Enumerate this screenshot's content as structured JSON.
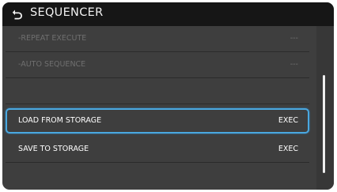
{
  "header": {
    "title": "SEQUENCER",
    "back_icon": "back-arrow-icon"
  },
  "rows": [
    {
      "label": "-REPEAT EXECUTE",
      "value": "---",
      "state": "disabled"
    },
    {
      "label": "-AUTO SEQUENCE",
      "value": "---",
      "state": "disabled"
    },
    {
      "label": "",
      "value": "",
      "state": "empty"
    },
    {
      "label": "LOAD FROM STORAGE",
      "value": "EXEC",
      "state": "selected"
    },
    {
      "label": "SAVE TO STORAGE",
      "value": "EXEC",
      "state": "normal"
    }
  ],
  "colors": {
    "highlight": "#4aa8e0",
    "background": "#3e3e3e",
    "header": "#161616"
  }
}
